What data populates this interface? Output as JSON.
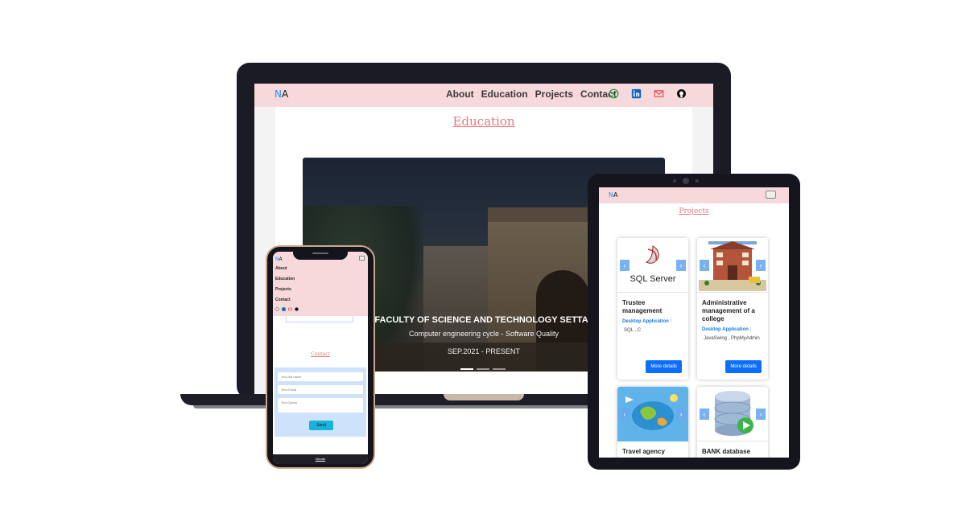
{
  "brand": {
    "n": "N",
    "a": "A"
  },
  "laptop": {
    "nav_links": [
      "About",
      "Education",
      "Projects",
      "Contact"
    ],
    "social_icons": [
      "whatsapp-icon",
      "linkedin-icon",
      "mail-icon",
      "github-icon"
    ],
    "section_title": "Education",
    "slide": {
      "title": "FACULTY OF SCIENCE AND TECHNOLOGY SETTAT",
      "subtitle": "Computer engineering cycle - Software Quality",
      "date": "SEP.2021 - PRESENT",
      "indicator_count": 3,
      "active_indicator": 1
    }
  },
  "tablet": {
    "section_title": "Projects",
    "toggler_icon": "hamburger-icon",
    "cards": [
      {
        "image": "SQL Server",
        "title": "Trustee management",
        "kind": "Desktop Application :",
        "tech": "SQL , C",
        "button": "More details"
      },
      {
        "image": "college-building",
        "title": "Administrative management of a college",
        "kind": "Desktop Application :",
        "tech": "JavaSwing , PhpMyAdmin",
        "button": "More details"
      },
      {
        "image": "travel-map",
        "title": "Travel agency",
        "kind": "",
        "tech": "",
        "button": ""
      },
      {
        "image": "database-cylinder",
        "title": "BANK database",
        "kind": "",
        "tech": "",
        "button": ""
      }
    ]
  },
  "phone": {
    "menu_items": [
      "About",
      "Education",
      "Projects",
      "Contact"
    ],
    "contact_title": "Contact",
    "form": {
      "name_placeholder": "Your full name",
      "email_placeholder": "Your Email",
      "query_placeholder": "Your Query",
      "send_label": "Send"
    },
    "footer": "Nlcode"
  },
  "colors": {
    "nav_bg": "#f7d9dc",
    "accent_title": "#e8787f",
    "primary": "#0d6efd",
    "send_button": "#17b3dd",
    "brand_n": "#1e90ff"
  }
}
